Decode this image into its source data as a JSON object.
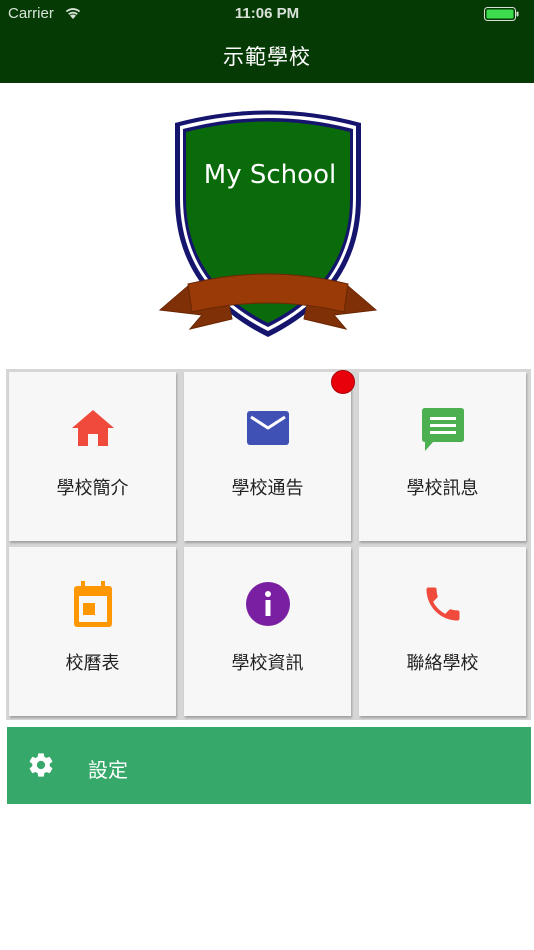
{
  "status_bar": {
    "carrier": "Carrier",
    "time": "11:06 PM",
    "wifi_icon": "wifi-icon",
    "battery_icon": "battery-icon"
  },
  "header": {
    "title": "示範學校",
    "background_color": "#053a05"
  },
  "logo": {
    "text": "My School",
    "shield_color": "#0a6b0a",
    "ribbon_color": "#9a3a06"
  },
  "menu": {
    "items": [
      {
        "label": "學校簡介",
        "icon": "home-icon",
        "color": "#ef4a3c"
      },
      {
        "label": "學校通告",
        "icon": "mail-icon",
        "color": "#3f51b5",
        "has_notification": true
      },
      {
        "label": "學校訊息",
        "icon": "message-icon",
        "color": "#4caf50"
      },
      {
        "label": "校曆表",
        "icon": "calendar-icon",
        "color": "#ff9800"
      },
      {
        "label": "學校資訊",
        "icon": "info-icon",
        "color": "#7b1fa2"
      },
      {
        "label": "聯絡學校",
        "icon": "phone-icon",
        "color": "#ef4a3c"
      }
    ],
    "notification_badge_color": "#e8000b"
  },
  "settings": {
    "label": "設定",
    "icon": "gear-icon",
    "background_color": "#36a869"
  }
}
